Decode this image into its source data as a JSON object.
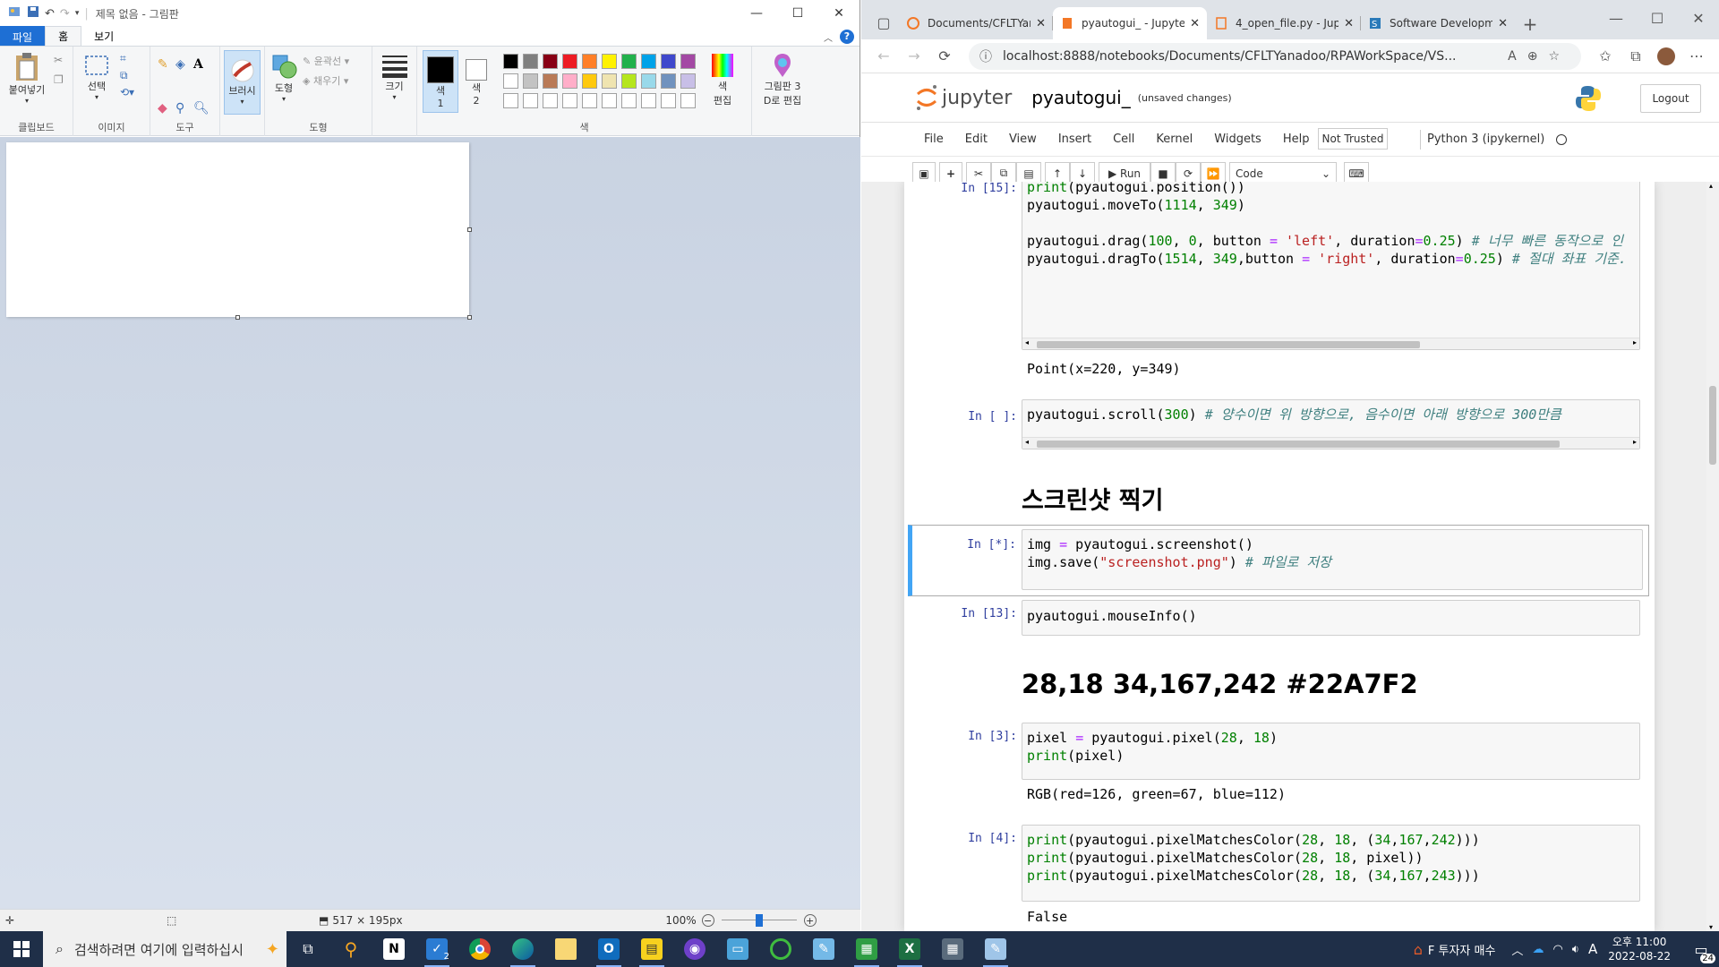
{
  "paint": {
    "title": "제목 없음 - 그림판",
    "tabs": {
      "file": "파일",
      "home": "홈",
      "view": "보기"
    },
    "groups": {
      "clipboard": {
        "label": "클립보드",
        "paste": "붙여넣기"
      },
      "image": {
        "label": "이미지",
        "select": "선택"
      },
      "tools": {
        "label": "도구"
      },
      "brush": {
        "label": "브러시"
      },
      "shapes": {
        "label": "도형",
        "shapes_btn": "도형",
        "outline": "윤곽선",
        "fill": "채우기"
      },
      "size": {
        "label": "크기"
      },
      "colors": {
        "label": "색",
        "color1_a": "색",
        "color1_b": "1",
        "color2_a": "색",
        "color2_b": "2",
        "edit_a": "색",
        "edit_b": "편집"
      },
      "paint3d": {
        "line1": "그림판 3",
        "line2": "D로 편집"
      }
    },
    "palette": [
      "#000000",
      "#7f7f7f",
      "#880015",
      "#ed1c24",
      "#ff7f27",
      "#fff200",
      "#22b14c",
      "#00a2e8",
      "#3f48cc",
      "#a349a4",
      "#ffffff",
      "#c3c3c3",
      "#b97a57",
      "#ffaec9",
      "#ffc90e",
      "#efe4b0",
      "#b5e61d",
      "#99d9ea",
      "#7092be",
      "#c8bfe7",
      "#ffffff",
      "#ffffff",
      "#ffffff",
      "#ffffff",
      "#ffffff",
      "#ffffff",
      "#ffffff",
      "#ffffff",
      "#ffffff",
      "#ffffff"
    ],
    "status": {
      "canvas_size": "517 × 195px",
      "zoom": "100%"
    }
  },
  "browser": {
    "tabs": [
      {
        "label": "Documents/CFLTYanadoo/",
        "color": "#f37726"
      },
      {
        "label": "pyautogui_ - Jupyter",
        "color": "#f37726"
      },
      {
        "label": "4_open_file.py - Jupy",
        "color": "#f37726"
      },
      {
        "label": "Software Developmen",
        "color": "#2a7ab9"
      }
    ],
    "url": "localhost:8888/notebooks/Documents/CFLTYanadoo/RPAWorkSpace/VS...",
    "jupyter": {
      "logo": "jupyter",
      "notebook_name": "pyautogui_",
      "save_status": "(unsaved changes)",
      "logout": "Logout",
      "menu": [
        "File",
        "Edit",
        "View",
        "Insert",
        "Cell",
        "Kernel",
        "Widgets",
        "Help"
      ],
      "trust": "Not Trusted",
      "kernel": "Python 3 (ipykernel)",
      "run": "Run",
      "cell_type": "Code"
    },
    "cells": {
      "c15_prompt": "In [15]:",
      "c15_out": "Point(x=220, y=349)",
      "cscroll_prompt": "In [ ]:",
      "md_screenshot": "스크린샷 찍기",
      "cshot_prompt": "In [*]:",
      "c13_prompt": "In [13]:",
      "c13_code": "pyautogui.mouseInfo()",
      "md_pixel": "28,18 34,167,242 #22A7F2",
      "c3_prompt": "In [3]:",
      "c3_out": "RGB(red=126, green=67, blue=112)",
      "c4_prompt": "In [4]:",
      "c4_out": "False"
    }
  },
  "taskbar": {
    "search_placeholder": "검색하려면 여기에 입력하십시",
    "badge": "2",
    "tray_stock": "F 투자자 매수",
    "time": "오후 11:00",
    "date": "2022-08-22",
    "ime": "A",
    "notif": "24"
  }
}
